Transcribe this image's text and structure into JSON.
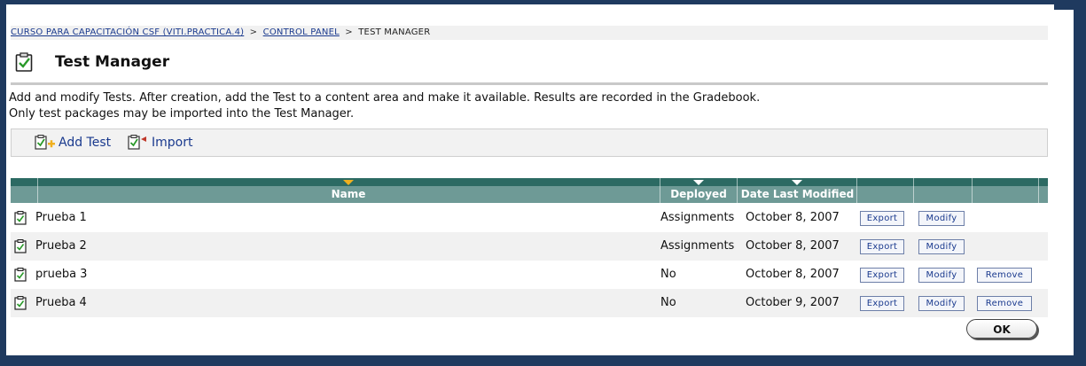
{
  "breadcrumb": {
    "course": "CURSO PARA CAPACITACIÓN CSF (VITI.PRACTICA.4)",
    "separator1": ">",
    "control_panel": "CONTROL PANEL",
    "separator2": ">",
    "current": "TEST MANAGER"
  },
  "page": {
    "title": "Test Manager",
    "description_line1": "Add and modify Tests. After creation, add the Test to a content area and make it available. Results are recorded in the Gradebook.",
    "description_line2": "Only test packages may be imported into the Test Manager."
  },
  "actions": {
    "add_test": "Add Test",
    "import": "Import"
  },
  "table": {
    "columns": {
      "name": "Name",
      "deployed": "Deployed",
      "date_modified": "Date Last Modified"
    },
    "rows": [
      {
        "name": "Prueba 1",
        "deployed": "Assignments",
        "date": "October 8, 2007",
        "export": "Export",
        "modify": "Modify"
      },
      {
        "name": "Prueba 2",
        "deployed": "Assignments",
        "date": "October 8, 2007",
        "export": "Export",
        "modify": "Modify"
      },
      {
        "name": "prueba 3",
        "deployed": "No",
        "date": "October 8, 2007",
        "export": "Export",
        "modify": "Modify",
        "remove": "Remove"
      },
      {
        "name": "Prueba 4",
        "deployed": "No",
        "date": "October 9, 2007",
        "export": "Export",
        "modify": "Modify",
        "remove": "Remove"
      }
    ]
  },
  "ok_label": "OK",
  "colors": {
    "frame": "#1f3a5f",
    "header_dark": "#2c6a63",
    "header": "#6e9a96",
    "link": "#1a3a8e",
    "sort_active": "#f0b020"
  },
  "icons": {
    "title": "test-clipboard-icon",
    "row": "clipboard-check-icon",
    "add": "add-test-icon",
    "import": "import-icon"
  }
}
